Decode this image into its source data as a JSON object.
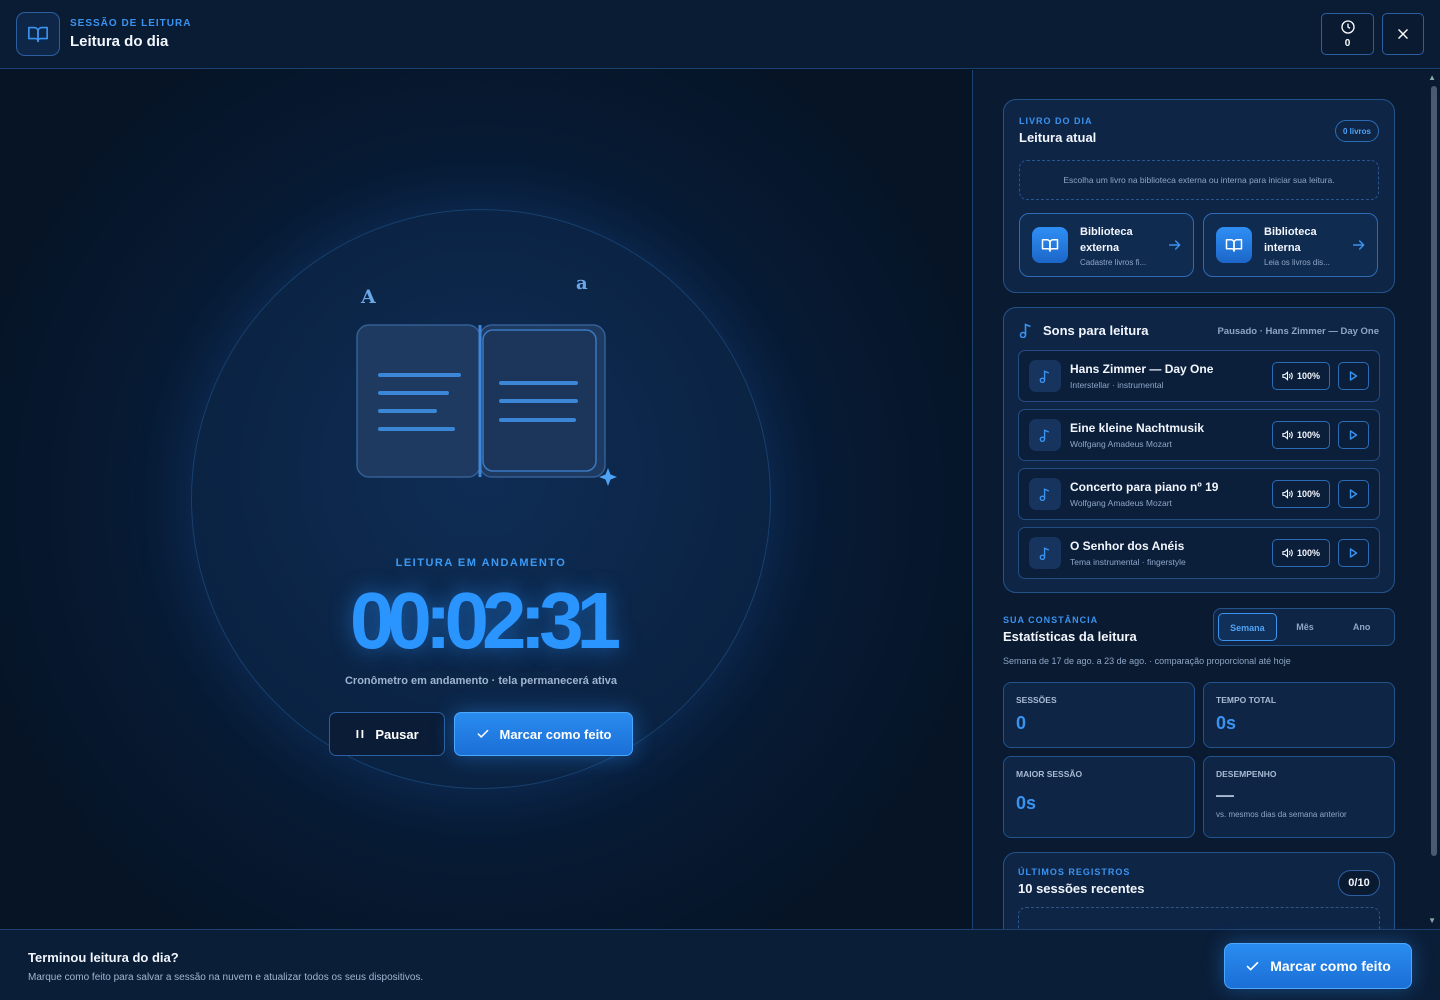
{
  "header": {
    "eyebrow": "SESSÃO DE LEITURA",
    "title": "Leitura do dia",
    "timer_count": "0",
    "icons": {
      "logo": "open-book-icon",
      "timer": "clock-icon",
      "close": "close-icon"
    }
  },
  "stage": {
    "status_label": "LEITURA EM ANDAMENTO",
    "clock": "00:02:31",
    "subtitle": "Cronômetro em andamento · tela permanecerá ativa",
    "pause_label": "Pausar",
    "done_label": "Marcar como feito",
    "decor_letters": [
      "A",
      "a"
    ]
  },
  "sidebar": {
    "book": {
      "eyebrow": "LIVRO DO DIA",
      "title": "Leitura atual",
      "count_badge": "0 livros",
      "empty_note": "Escolha um livro na biblioteca externa ou interna para iniciar sua leitura.",
      "libraries": [
        {
          "name_line1": "Biblioteca",
          "name_line2": "externa",
          "desc": "Cadastre livros fi..."
        },
        {
          "name_line1": "Biblioteca",
          "name_line2": "interna",
          "desc": "Leia os livros dis..."
        }
      ]
    },
    "sounds": {
      "title": "Sons para leitura",
      "status": "Pausado · Hans Zimmer — Day One",
      "tracks": [
        {
          "name": "Hans Zimmer — Day One",
          "sub": "Interstellar · instrumental",
          "volume": "100%"
        },
        {
          "name": "Eine kleine Nachtmusik",
          "sub": "Wolfgang Amadeus Mozart",
          "volume": "100%"
        },
        {
          "name": "Concerto para piano nº 19",
          "sub": "Wolfgang Amadeus Mozart",
          "volume": "100%"
        },
        {
          "name": "O Senhor dos Anéis",
          "sub": "Tema instrumental · fingerstyle",
          "volume": "100%"
        }
      ]
    },
    "stats": {
      "eyebrow": "SUA CONSTÂNCIA",
      "title": "Estatísticas da leitura",
      "tabs": [
        "Semana",
        "Mês",
        "Ano"
      ],
      "active_tab": "Semana",
      "subtitle": "Semana de 17 de ago. a 23 de ago. · comparação proporcional até hoje",
      "cards": [
        {
          "label": "SESSÕES",
          "value": "0"
        },
        {
          "label": "TEMPO TOTAL",
          "value": "0s"
        },
        {
          "label": "MAIOR SESSÃO",
          "value": "0s"
        },
        {
          "label": "DESEMPENHO",
          "value": "—",
          "foot": "vs. mesmos dias da semana anterior"
        }
      ]
    },
    "recent": {
      "eyebrow": "ÚLTIMOS REGISTROS",
      "title": "10 sessões recentes",
      "count": "0/10"
    }
  },
  "footer": {
    "title": "Terminou leitura do dia?",
    "subtitle": "Marque como feito para salvar a sessão na nuvem e atualizar todos os seus dispositivos.",
    "button_label": "Marcar como feito"
  },
  "colors": {
    "accent": "#2a94ff",
    "background": "#061426",
    "panel": "#0e2546",
    "border": "#24538c"
  }
}
